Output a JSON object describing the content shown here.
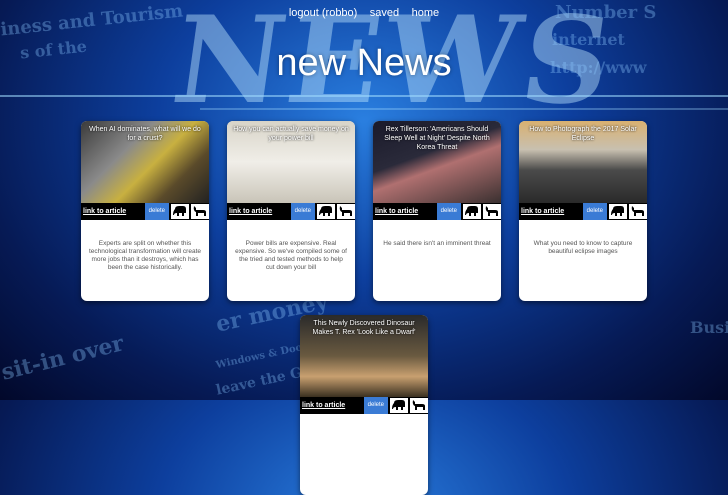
{
  "nav": {
    "logout": "logout (robbo)",
    "saved": "saved",
    "home": "home"
  },
  "title": "new News",
  "background": {
    "big_word": "NEWS",
    "words": [
      "Number S",
      "internet",
      "http://www",
      "er money",
      "sit-in over",
      "Windows & Doors",
      "leave the Goose",
      "Business",
      "iness and Tourism",
      "s of the"
    ]
  },
  "cards": [
    {
      "headline": "When AI dominates, what will we do for a crust?",
      "link": "link to article",
      "delete": "delete",
      "desc": "Experts are split on whether this technological transformation will create more jobs than it destroys, which has been the case historically."
    },
    {
      "headline": "How you can actually save money on your power bill",
      "link": "link to article",
      "delete": "delete",
      "desc": "Power bills are expensive. Real expensive. So we've compiled some of the tried and tested methods to help cut down your bill"
    },
    {
      "headline": "Rex Tillerson: 'Americans Should Sleep Well at Night' Despite North Korea Threat",
      "link": "link to article",
      "delete": "delete",
      "desc": "He said there isn't an imminent threat"
    },
    {
      "headline": "How to Photograph the 2017 Solar Eclipse",
      "link": "link to article",
      "delete": "delete",
      "desc": "What you need to know to capture beautiful eclipse images"
    },
    {
      "headline": "This Newly Discovered Dinosaur Makes T. Rex 'Look Like a Dwarf'",
      "link": "link to article",
      "delete": "delete",
      "desc": ""
    }
  ],
  "icons": {
    "elephant": "elephant-icon",
    "donkey": "donkey-icon"
  }
}
